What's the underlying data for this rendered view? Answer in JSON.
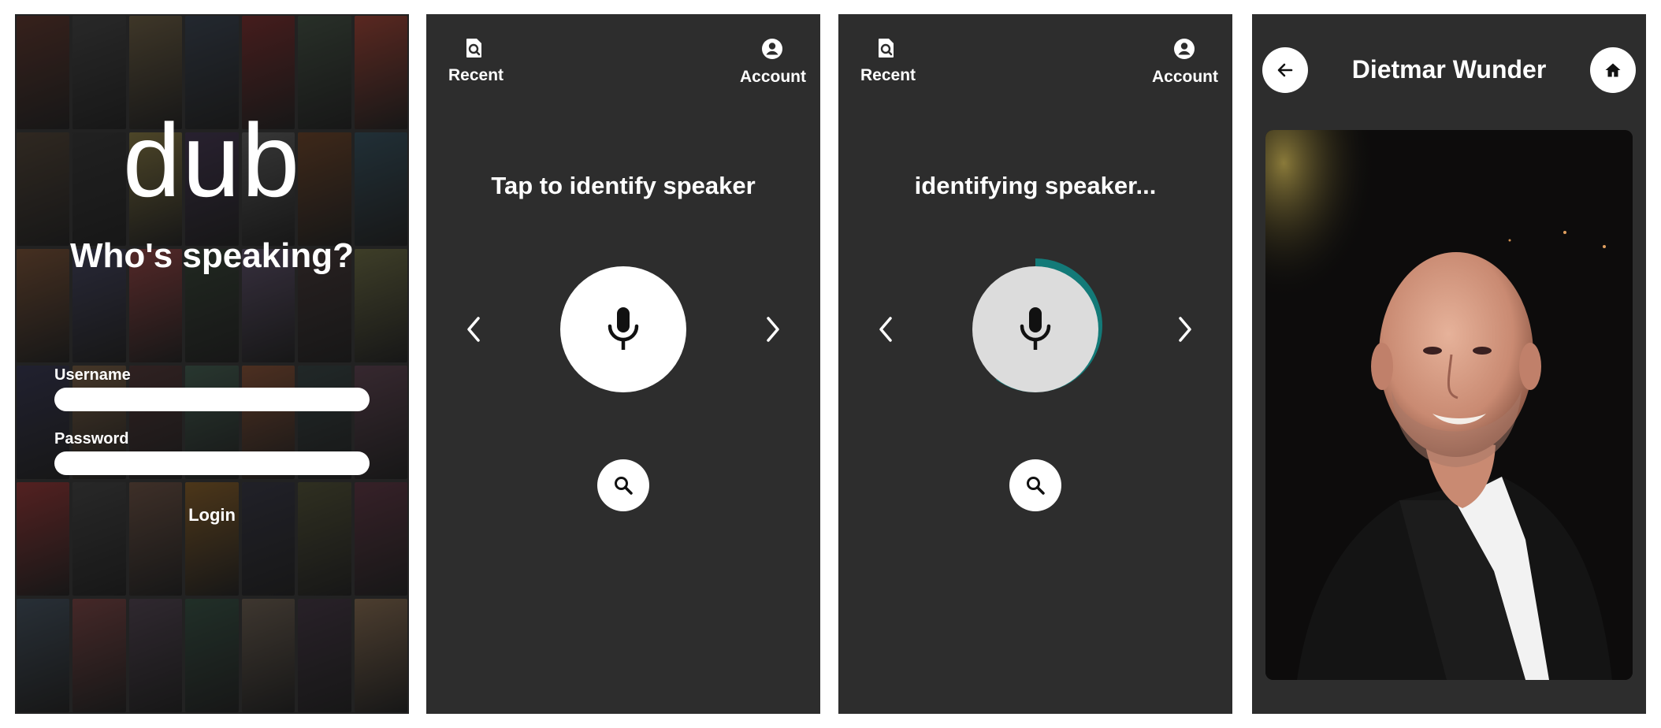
{
  "login": {
    "brand": "dub",
    "tagline": "Who's speaking?",
    "username_label": "Username",
    "username_value": "",
    "password_label": "Password",
    "password_value": "",
    "login_label": "Login",
    "poster_colors": [
      "#5a2a1f",
      "#3b3b3b",
      "#6b5a3a",
      "#2f3a4a",
      "#7a2020",
      "#3a4a3a",
      "#a83a2a",
      "#4a3a2a",
      "#2a2a2a",
      "#8a7a3a",
      "#3a2a4a",
      "#5a5a5a",
      "#6a3a1a",
      "#2a4a5a",
      "#7a4a2a",
      "#3a3a5a",
      "#9a3a3a",
      "#2a3a2a",
      "#5a4a6a",
      "#3a2a2a",
      "#6a6a3a",
      "#2a2a4a",
      "#7a5a3a",
      "#4a2a2a",
      "#3a5a4a",
      "#8a4a2a",
      "#2a3a3a",
      "#5a3a4a",
      "#9a2a2a",
      "#3a3a3a",
      "#6a4a3a",
      "#8a5a1a",
      "#2a2a3a",
      "#4a4a2a",
      "#5a2a3a",
      "#3a4a5a",
      "#7a3a3a",
      "#4a3a4a",
      "#2a4a3a",
      "#6a5a4a",
      "#3a2a3a",
      "#8a6a4a"
    ]
  },
  "identify_idle": {
    "nav_recent": "Recent",
    "nav_account": "Account",
    "prompt": "Tap to identify speaker"
  },
  "identify_busy": {
    "nav_recent": "Recent",
    "nav_account": "Account",
    "prompt": "identifying speaker...",
    "progress": 0.6
  },
  "result": {
    "speaker_name": "Dietmar Wunder"
  },
  "colors": {
    "screen_bg": "#2d2d2d",
    "accent_ring": "#137a78",
    "icon_dark": "#111111"
  }
}
